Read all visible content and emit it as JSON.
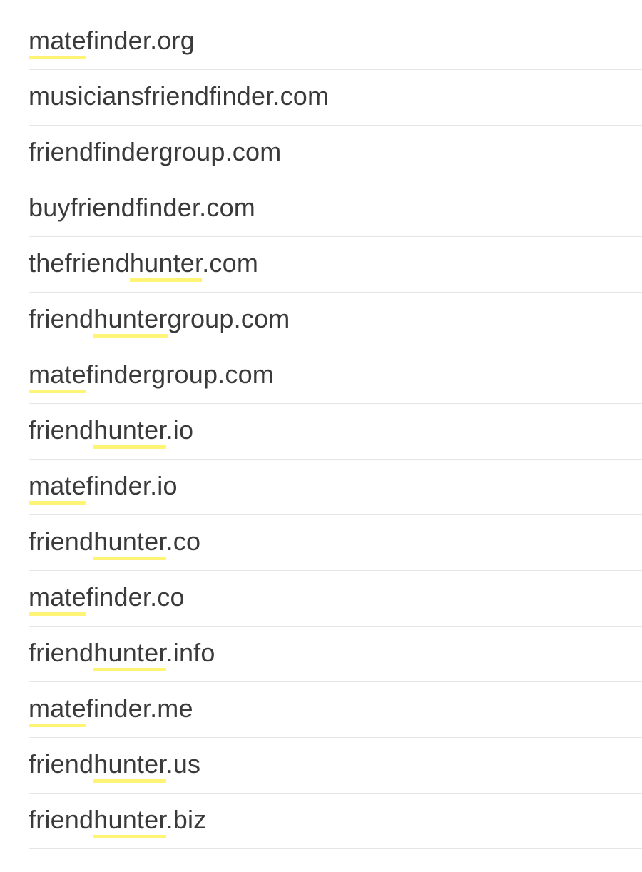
{
  "colors": {
    "highlight": "#fff475",
    "text": "#3a3a3a",
    "divider": "#e6e6e6"
  },
  "domains": [
    {
      "parts": [
        {
          "t": "mate",
          "h": true
        },
        {
          "t": "finder.org",
          "h": false
        }
      ]
    },
    {
      "parts": [
        {
          "t": "musiciansfriendfinder.com",
          "h": false
        }
      ]
    },
    {
      "parts": [
        {
          "t": "friendfindergroup.com",
          "h": false
        }
      ]
    },
    {
      "parts": [
        {
          "t": "buyfriendfinder.com",
          "h": false
        }
      ]
    },
    {
      "parts": [
        {
          "t": "thefriend",
          "h": false
        },
        {
          "t": "hunter",
          "h": true
        },
        {
          "t": ".com",
          "h": false
        }
      ]
    },
    {
      "parts": [
        {
          "t": "friend",
          "h": false
        },
        {
          "t": "hunter",
          "h": true
        },
        {
          "t": "group.com",
          "h": false
        }
      ]
    },
    {
      "parts": [
        {
          "t": "mate",
          "h": true
        },
        {
          "t": "findergroup.com",
          "h": false
        }
      ]
    },
    {
      "parts": [
        {
          "t": "friend",
          "h": false
        },
        {
          "t": "hunter",
          "h": true
        },
        {
          "t": ".io",
          "h": false
        }
      ]
    },
    {
      "parts": [
        {
          "t": "mate",
          "h": true
        },
        {
          "t": "finder.io",
          "h": false
        }
      ]
    },
    {
      "parts": [
        {
          "t": "friend",
          "h": false
        },
        {
          "t": "hunter",
          "h": true
        },
        {
          "t": ".co",
          "h": false
        }
      ]
    },
    {
      "parts": [
        {
          "t": "mate",
          "h": true
        },
        {
          "t": "finder.co",
          "h": false
        }
      ]
    },
    {
      "parts": [
        {
          "t": "friend",
          "h": false
        },
        {
          "t": "hunter",
          "h": true
        },
        {
          "t": ".info",
          "h": false
        }
      ]
    },
    {
      "parts": [
        {
          "t": "mate",
          "h": true
        },
        {
          "t": "finder.me",
          "h": false
        }
      ]
    },
    {
      "parts": [
        {
          "t": "friend",
          "h": false
        },
        {
          "t": "hunter",
          "h": true
        },
        {
          "t": ".us",
          "h": false
        }
      ]
    },
    {
      "parts": [
        {
          "t": "friend",
          "h": false
        },
        {
          "t": "hunter",
          "h": true
        },
        {
          "t": ".biz",
          "h": false
        }
      ]
    }
  ]
}
